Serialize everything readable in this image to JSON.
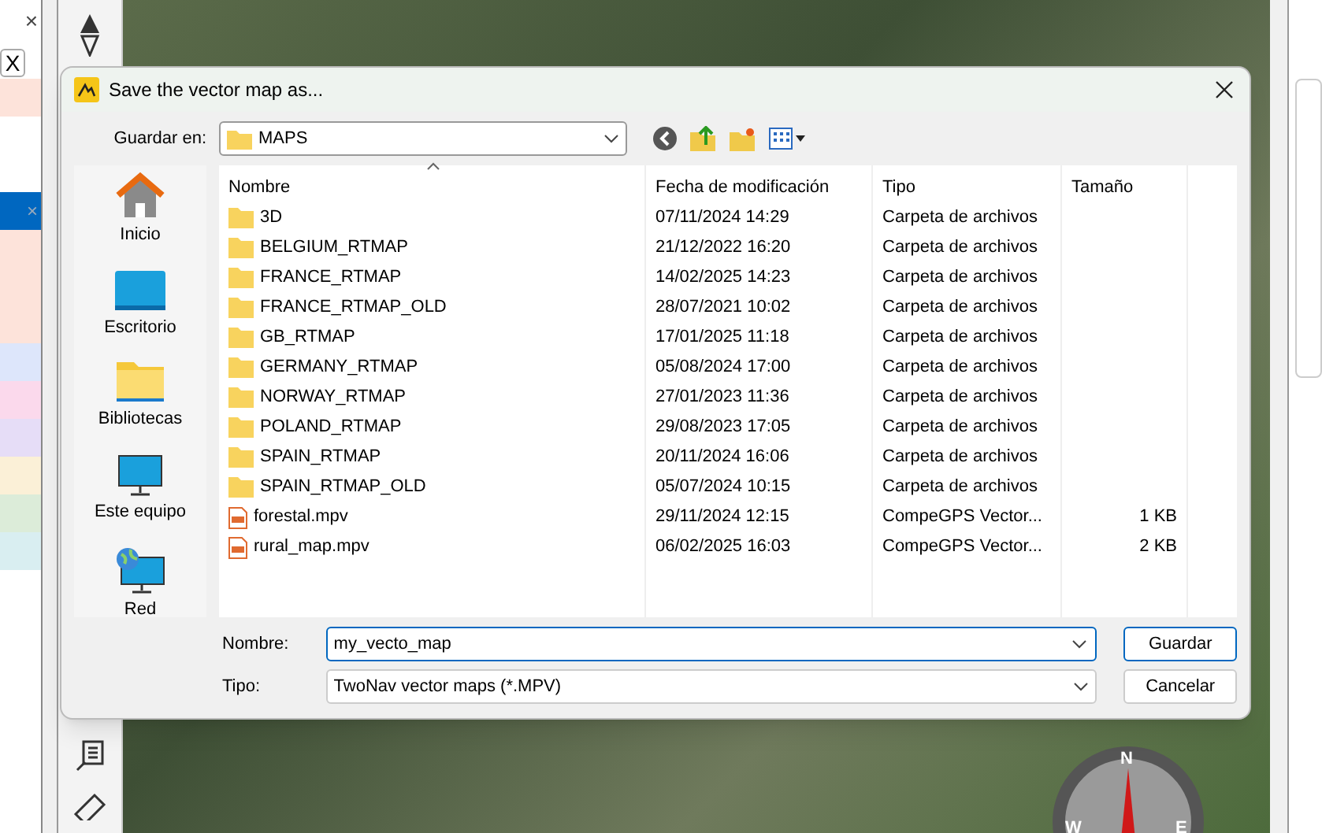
{
  "left_panel": {
    "close": "×",
    "clear_button": "X",
    "rows": [
      {
        "color": "#fde3da",
        "selected": false
      },
      {
        "color": "#0067c0",
        "selected": true
      },
      {
        "color": "#fde3da",
        "selected": false
      },
      {
        "color": "#fde3da",
        "selected": false
      },
      {
        "color": "#fde3da",
        "selected": false
      },
      {
        "color": "#dde6fb",
        "selected": false
      },
      {
        "color": "#fbd9ec",
        "selected": false
      },
      {
        "color": "#e6ddf7",
        "selected": false
      },
      {
        "color": "#fbf0d7",
        "selected": false
      },
      {
        "color": "#dcecd9",
        "selected": false
      },
      {
        "color": "#d9eef1",
        "selected": false
      }
    ]
  },
  "dialog": {
    "title": "Save the vector map as...",
    "save_in_label": "Guardar en:",
    "folder": "MAPS",
    "places": [
      {
        "kind": "home",
        "label": "Inicio"
      },
      {
        "kind": "desktop",
        "label": "Escritorio"
      },
      {
        "kind": "libraries",
        "label": "Bibliotecas"
      },
      {
        "kind": "computer",
        "label": "Este equipo"
      },
      {
        "kind": "network",
        "label": "Red"
      }
    ],
    "columns": [
      "Nombre",
      "Fecha de modificación",
      "Tipo",
      "Tamaño"
    ],
    "rows": [
      {
        "kind": "folder",
        "name": "3D",
        "date": "07/11/2024 14:29",
        "type": "Carpeta de archivos"
      },
      {
        "kind": "folder",
        "name": "BELGIUM_RTMAP",
        "date": "21/12/2022 16:20",
        "type": "Carpeta de archivos"
      },
      {
        "kind": "folder",
        "name": "FRANCE_RTMAP",
        "date": "14/02/2025 14:23",
        "type": "Carpeta de archivos"
      },
      {
        "kind": "folder",
        "name": "FRANCE_RTMAP_OLD",
        "date": "28/07/2021 10:02",
        "type": "Carpeta de archivos"
      },
      {
        "kind": "folder",
        "name": "GB_RTMAP",
        "date": "17/01/2025 11:18",
        "type": "Carpeta de archivos"
      },
      {
        "kind": "folder",
        "name": "GERMANY_RTMAP",
        "date": "05/08/2024 17:00",
        "type": "Carpeta de archivos"
      },
      {
        "kind": "folder",
        "name": "NORWAY_RTMAP",
        "date": "27/01/2023 11:36",
        "type": "Carpeta de archivos"
      },
      {
        "kind": "folder",
        "name": "POLAND_RTMAP",
        "date": "29/08/2023 17:05",
        "type": "Carpeta de archivos"
      },
      {
        "kind": "folder",
        "name": "SPAIN_RTMAP",
        "date": "20/11/2024 16:06",
        "type": "Carpeta de archivos"
      },
      {
        "kind": "folder",
        "name": "SPAIN_RTMAP_OLD",
        "date": "05/07/2024 10:15",
        "type": "Carpeta de archivos"
      },
      {
        "kind": "file",
        "name": "forestal.mpv",
        "date": "29/11/2024 12:15",
        "type": "CompeGPS Vector...",
        "size": "1 KB"
      },
      {
        "kind": "file",
        "name": "rural_map.mpv",
        "date": "06/02/2025 16:03",
        "type": "CompeGPS Vector...",
        "size": "2 KB"
      }
    ],
    "name_label": "Nombre:",
    "name_value": "my_vecto_map",
    "type_label": "Tipo:",
    "type_value": "TwoNav vector maps (*.MPV)",
    "buttons": [
      "Guardar",
      "Cancelar"
    ]
  },
  "compass": {
    "north": "N",
    "west": "W",
    "east": "E"
  }
}
